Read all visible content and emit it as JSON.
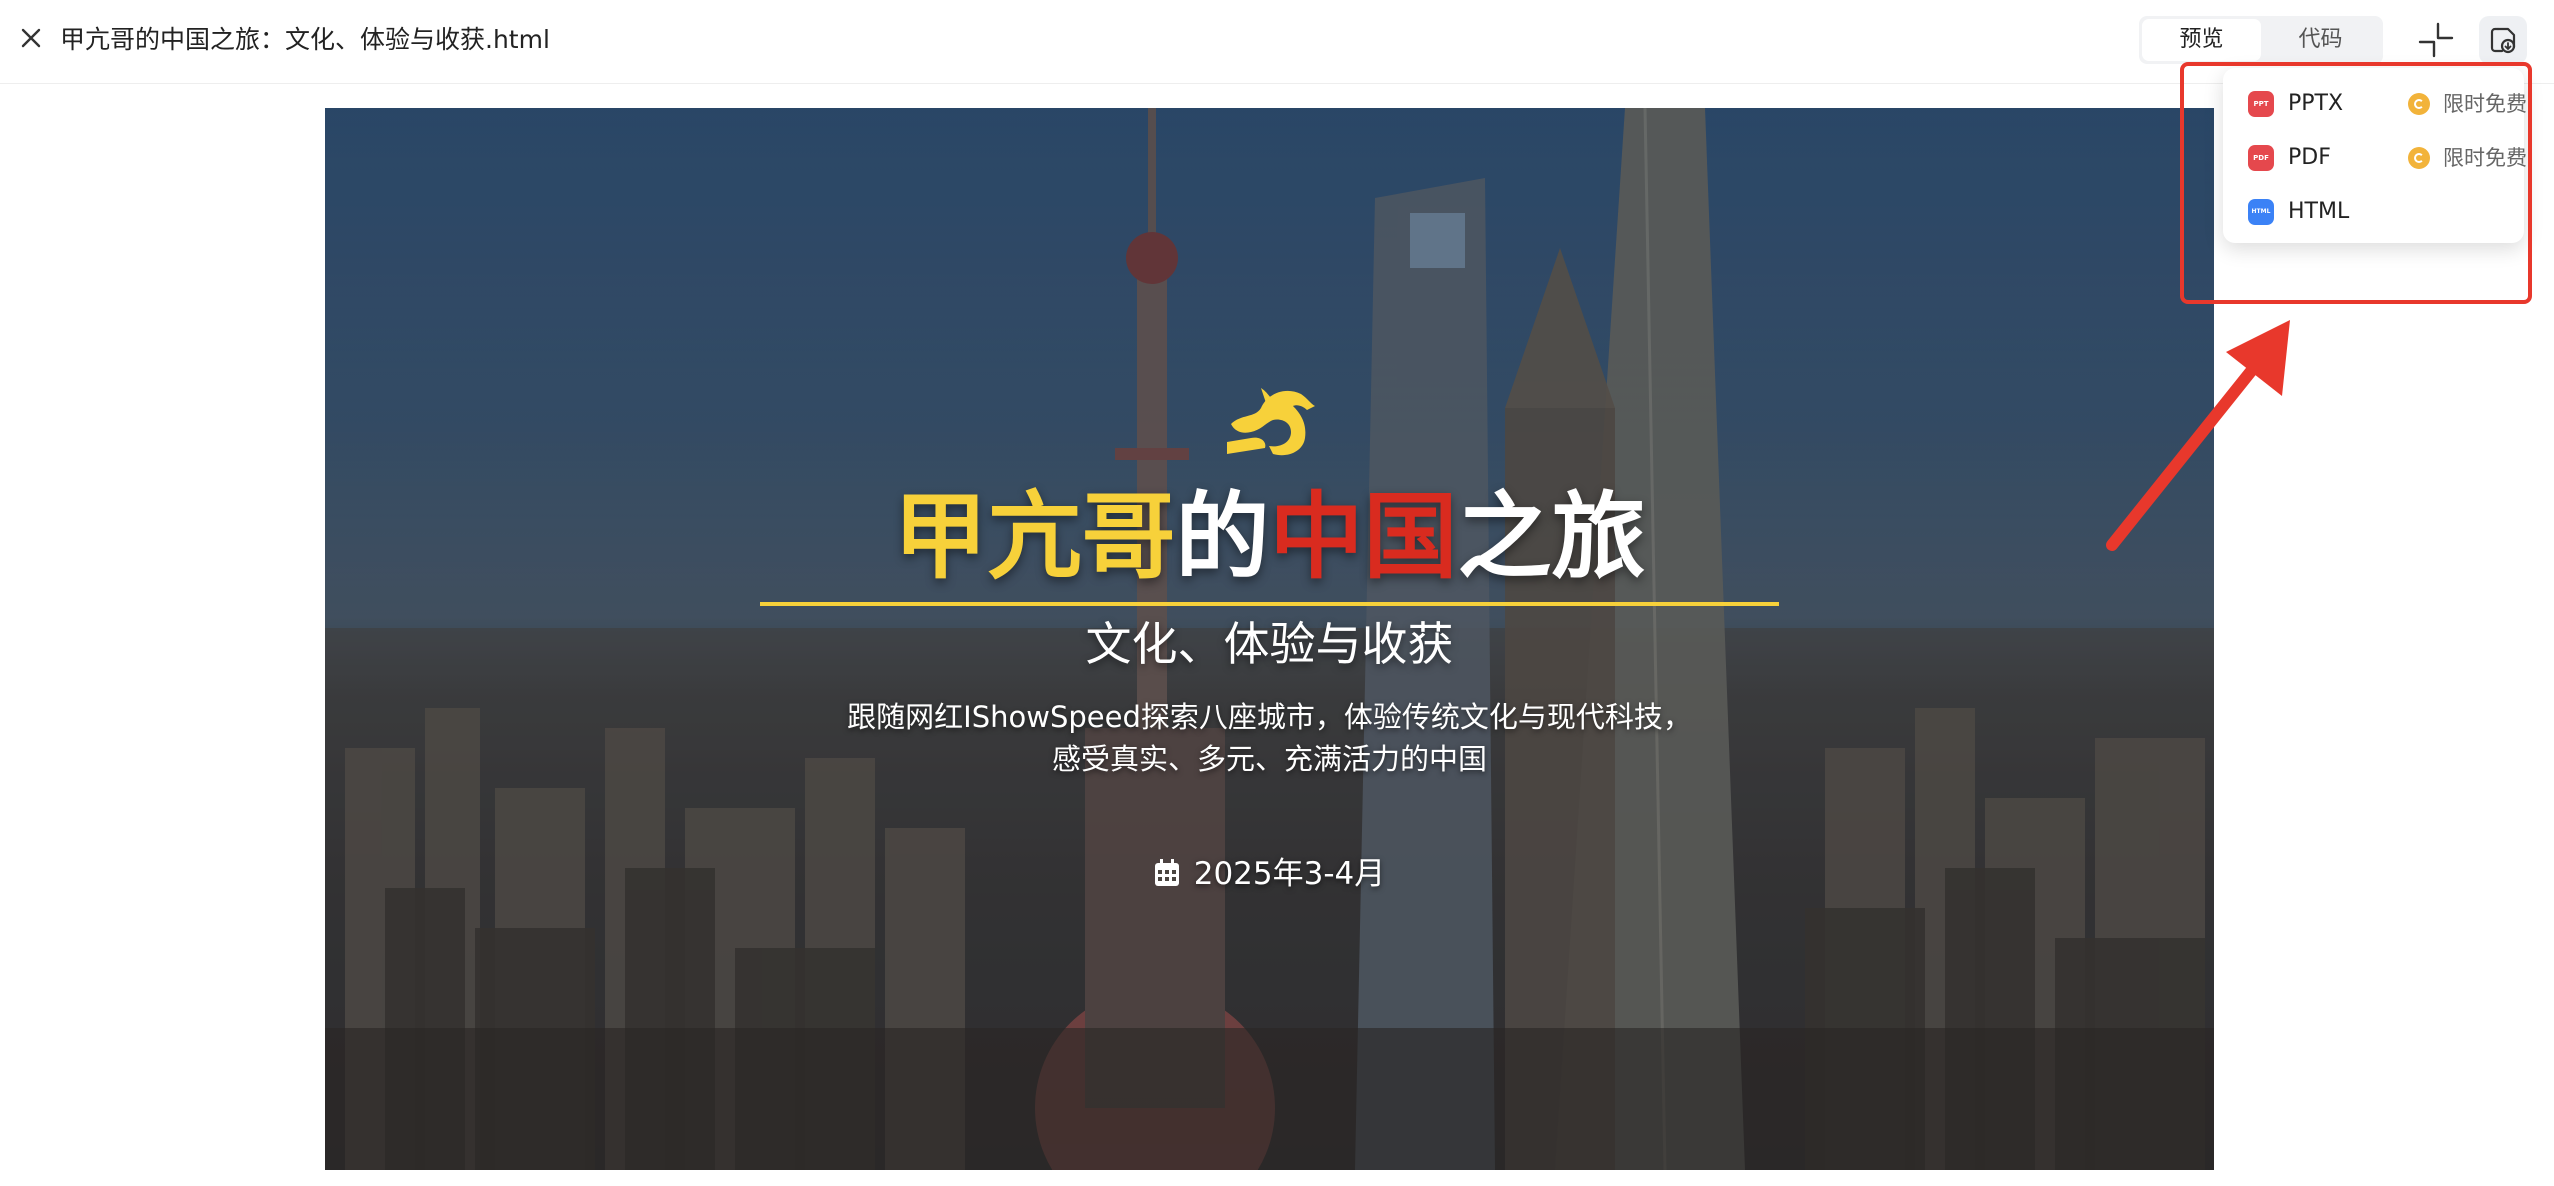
{
  "topbar": {
    "file_title": "甲亢哥的中国之旅：文化、体验与收获.html",
    "view_tabs": [
      {
        "label": "预览",
        "active": true
      },
      {
        "label": "代码",
        "active": false
      }
    ],
    "icons": {
      "close": "close-icon",
      "collapse": "collapse-icon",
      "download": "download-icon"
    }
  },
  "slide": {
    "title_parts": {
      "part1": "甲亢哥",
      "part2": "的",
      "part3": "中国",
      "part4": "之旅"
    },
    "subtitle": "文化、体验与收获",
    "description_line1": "跟随网红IShowSpeed探索八座城市，体验传统文化与现代科技，",
    "description_line2": "感受真实、多元、充满活力的中国",
    "date": "2025年3-4月",
    "logo": "dragon-logo",
    "colors": {
      "accent_yellow": "#f7d13a",
      "accent_red": "#d92b1f"
    }
  },
  "download_menu": {
    "items": [
      {
        "label": "PPTX",
        "badge": "PPT",
        "badge_color": "#e5484d",
        "free_label": "限时免费"
      },
      {
        "label": "PDF",
        "badge": "PDF",
        "badge_color": "#e5484d",
        "free_label": "限时免费"
      },
      {
        "label": "HTML",
        "badge": "HTML",
        "badge_color": "#3b82f6"
      }
    ]
  },
  "annotation": {
    "color": "#e8382c"
  }
}
